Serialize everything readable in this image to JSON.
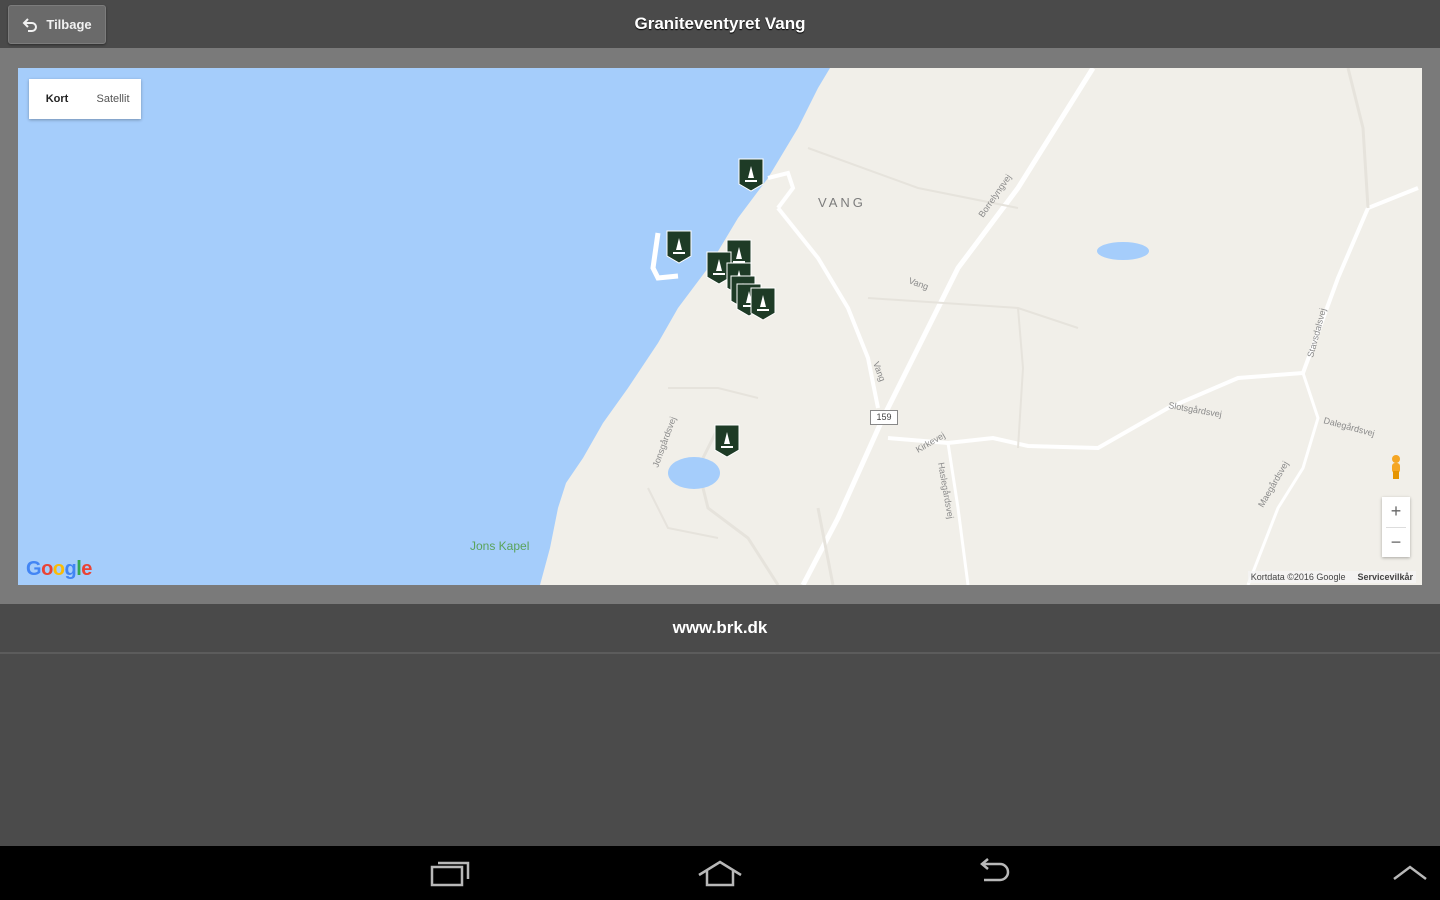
{
  "header": {
    "back_label": "Tilbage",
    "title": "Graniteventyret Vang"
  },
  "map": {
    "type_control": {
      "map": "Kort",
      "satellite": "Satellit"
    },
    "place_label": "VANG",
    "poi_label": "Jons Kapel",
    "road_number": "159",
    "attribution": "Kortdata ©2016 Google",
    "terms": "Servicevilkår",
    "zoom_in": "+",
    "zoom_out": "−",
    "google": [
      "G",
      "o",
      "o",
      "g",
      "l",
      "e"
    ],
    "marker_count": 10,
    "colors": {
      "water": "#a5cdfb",
      "land": "#f1efe9",
      "marker": "#1e3b26"
    }
  },
  "footer": {
    "link": "www.brk.dk"
  },
  "navbar": {
    "icons": [
      "recent-apps-icon",
      "home-icon",
      "back-icon",
      "chevron-up-icon"
    ]
  }
}
